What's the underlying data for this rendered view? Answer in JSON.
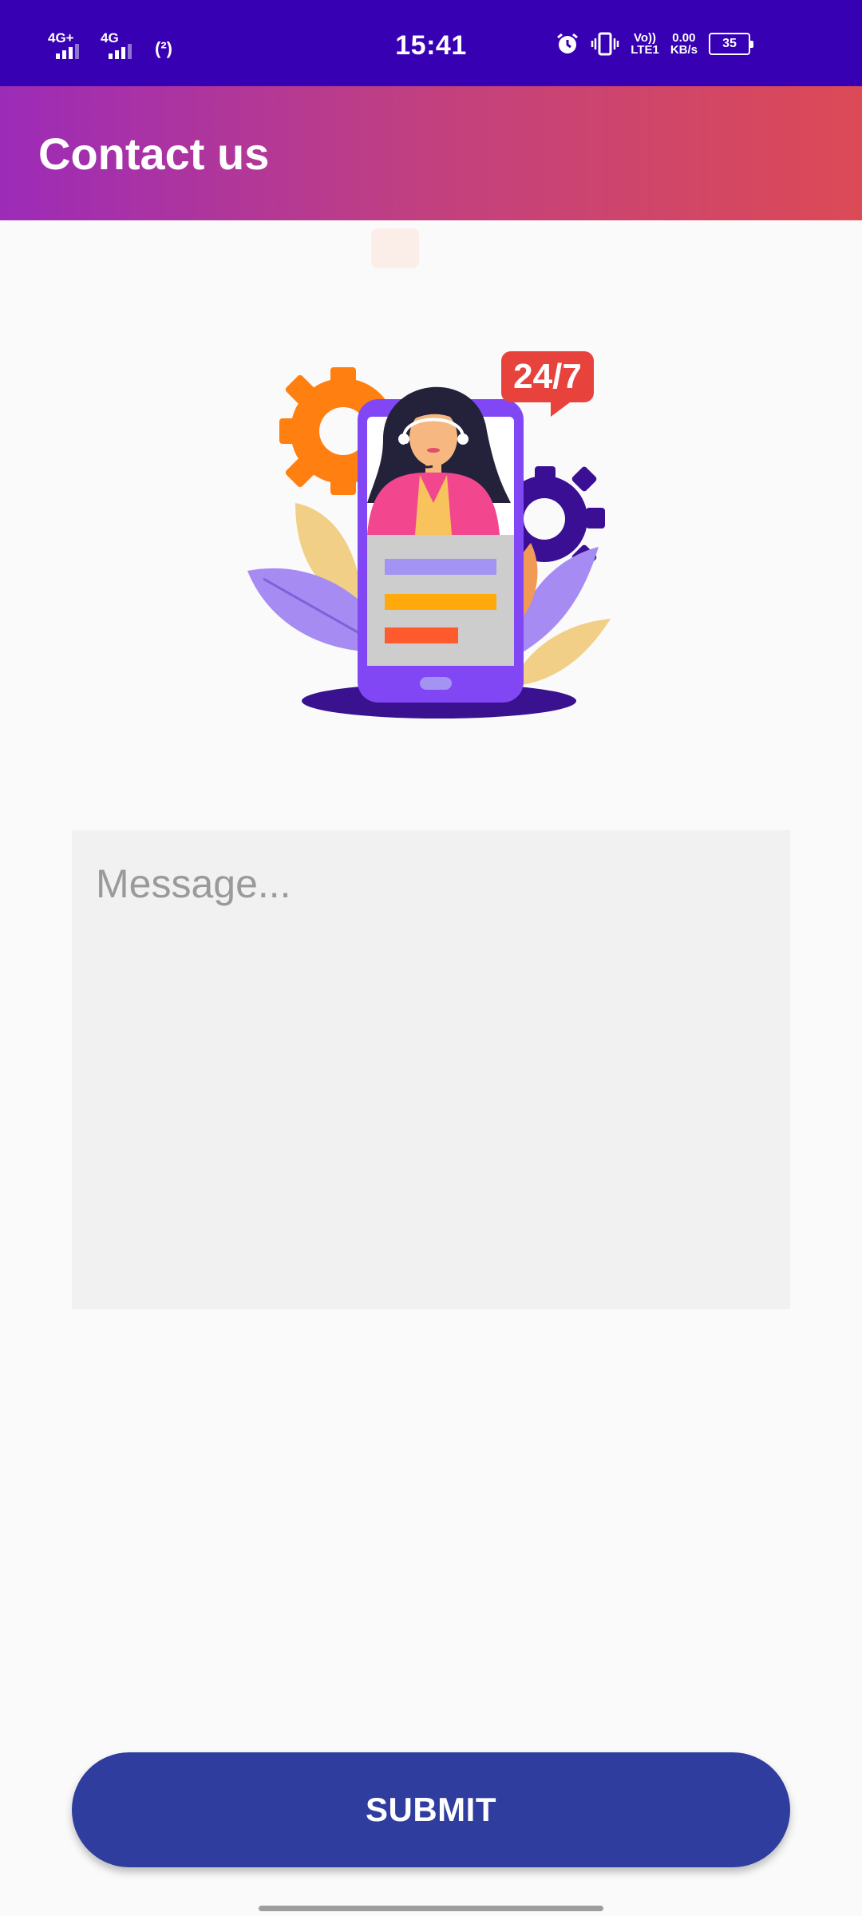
{
  "status_bar": {
    "network_1": "4G+",
    "network_2": "4G",
    "hotspot": "(²)",
    "time": "15:41",
    "volte_top": "Vo))",
    "volte_bottom": "LTE1",
    "speed_value": "0.00",
    "speed_unit": "KB/s",
    "battery": "35"
  },
  "app_bar": {
    "title": "Contact us"
  },
  "illustration": {
    "badge": "24/7"
  },
  "form": {
    "message_placeholder": "Message..."
  },
  "actions": {
    "submit_label": "SUBMIT"
  },
  "colors": {
    "status_bar": "#3700b3",
    "gradient_start": "#9c2bb8",
    "gradient_end": "#dc4a56",
    "submit_button": "#2f3d9e"
  }
}
